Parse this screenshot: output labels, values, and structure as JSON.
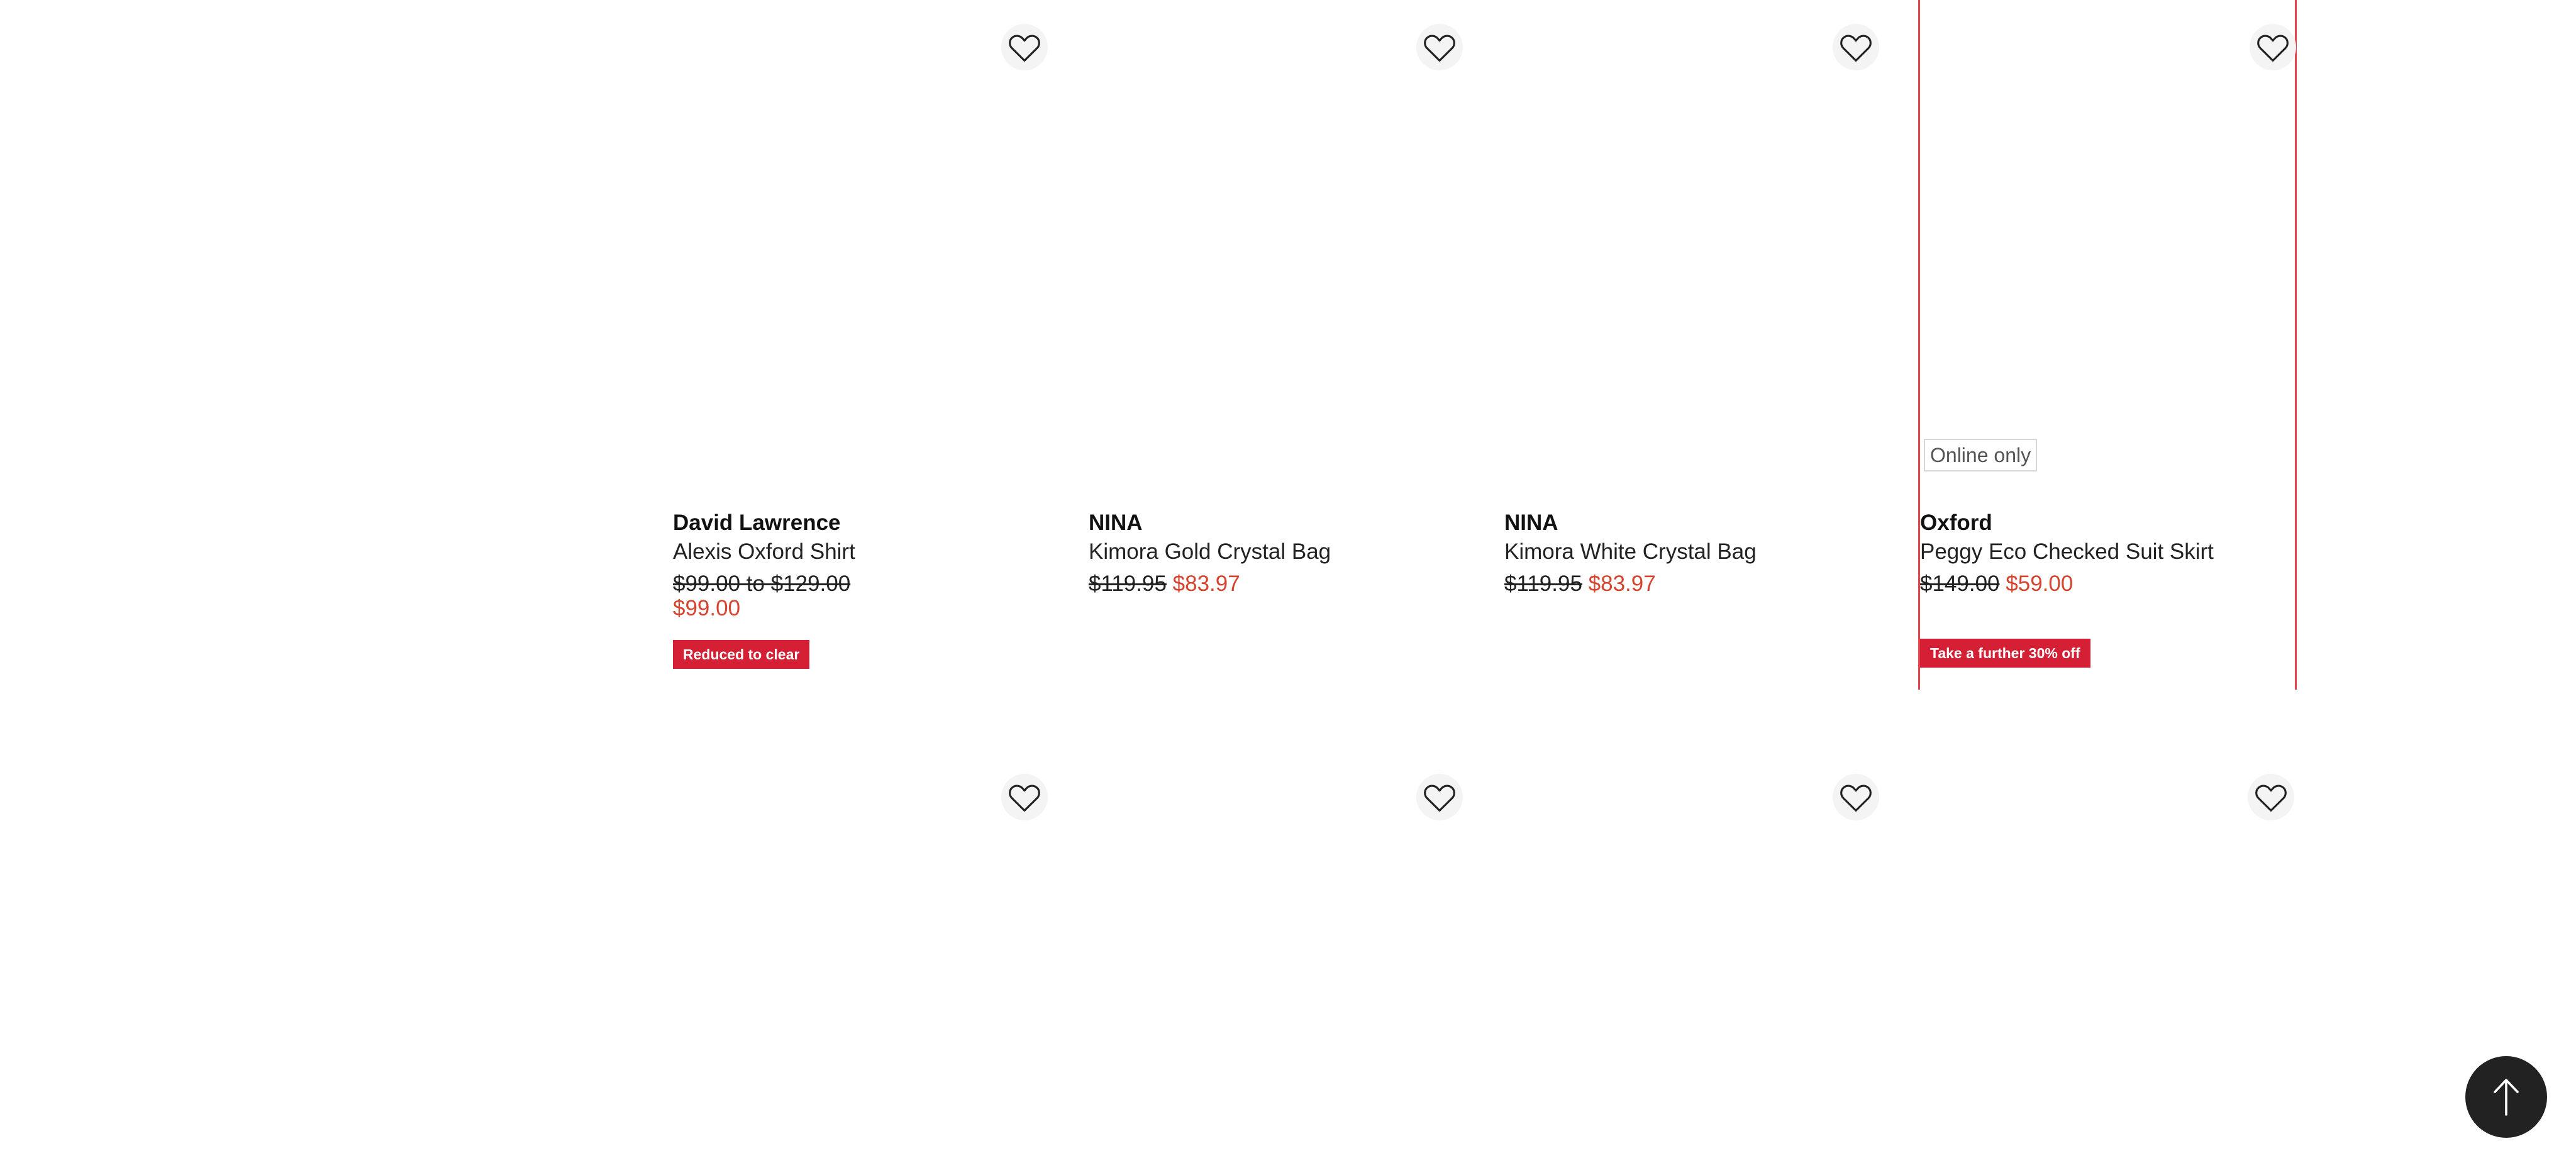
{
  "products_row1": [
    {
      "brand": "David Lawrence",
      "name": "Alexis Oxford Shirt",
      "was_price": "$99.00 to $129.00",
      "now_price": "$99.00",
      "promo_label": "Reduced to clear",
      "wishlist_icon": "heart-outline-icon"
    },
    {
      "brand": "NINA",
      "name": "Kimora Gold Crystal Bag",
      "was_price": "$119.95",
      "now_price": "$83.97",
      "wishlist_icon": "heart-outline-icon"
    },
    {
      "brand": "NINA",
      "name": "Kimora White Crystal Bag",
      "was_price": "$119.95",
      "now_price": "$83.97",
      "wishlist_icon": "heart-outline-icon"
    },
    {
      "brand": "Oxford",
      "name": "Peggy Eco Checked Suit Skirt",
      "was_price": "$149.00",
      "now_price": "$59.00",
      "badge": "Online only",
      "promo_label": "Take a further 30% off",
      "wishlist_icon": "heart-outline-icon"
    }
  ],
  "products_row2_wishlist_icons": [
    "heart-outline-icon",
    "heart-outline-icon",
    "heart-outline-icon",
    "heart-outline-icon"
  ],
  "back_to_top_icon": "arrow-up-icon",
  "colors": {
    "sale_price": "#d6432f",
    "promo_badge": "#d51f35",
    "highlight_border": "#e6424b",
    "back_to_top_bg": "#222222"
  }
}
